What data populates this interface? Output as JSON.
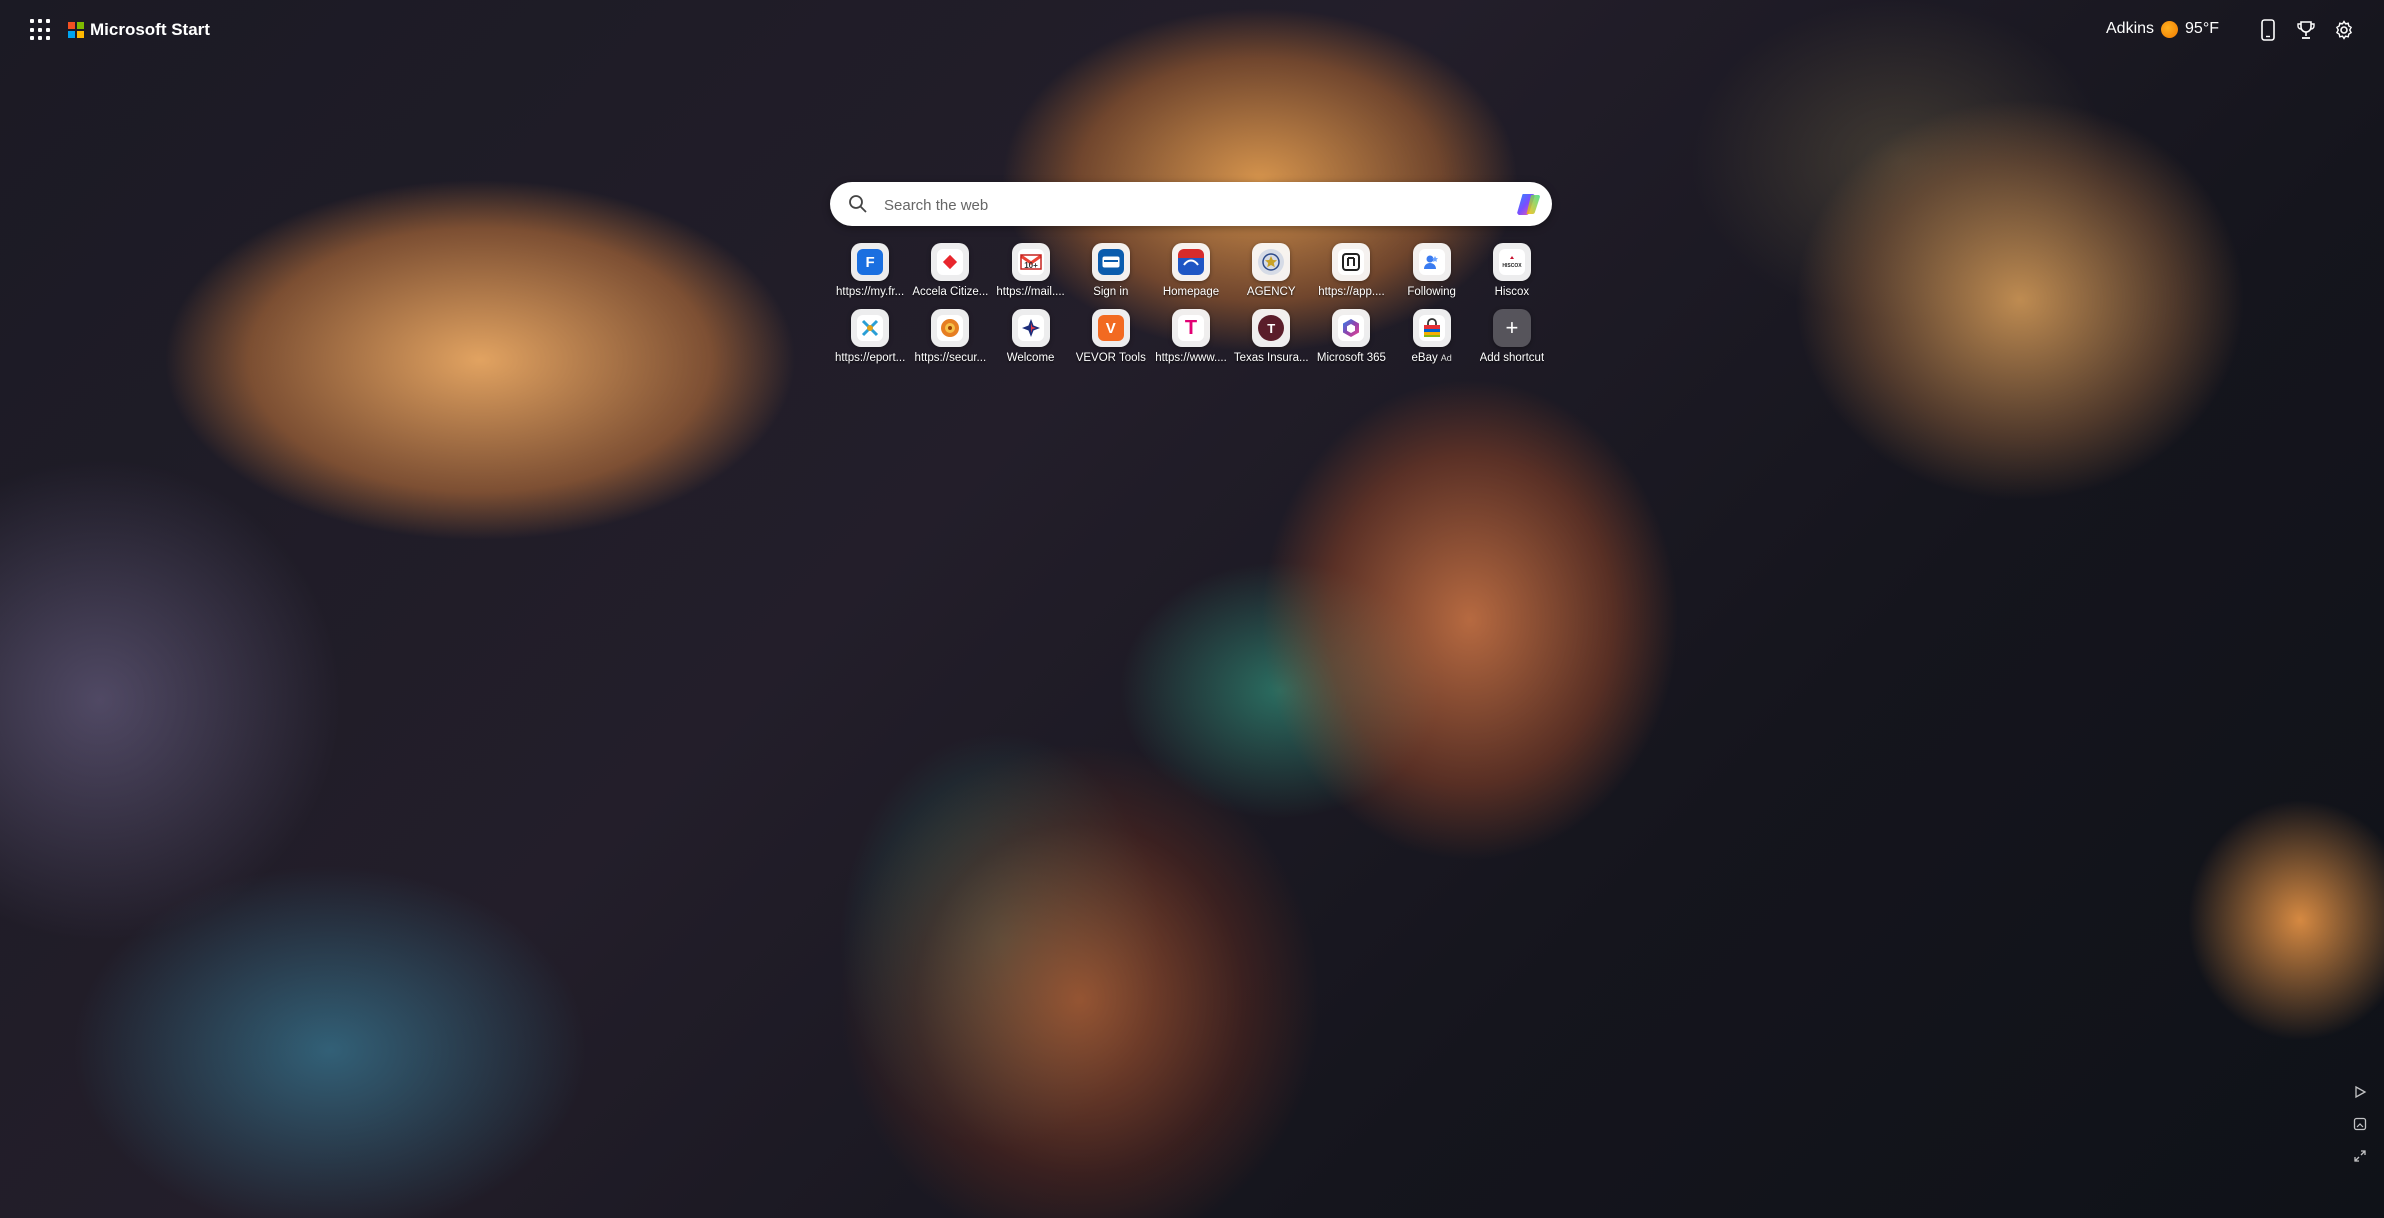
{
  "header": {
    "brand": "Microsoft Start",
    "weather_location": "Adkins",
    "weather_temp": "95°F",
    "colors": {
      "logo_red": "#f25022",
      "logo_green": "#7fba00",
      "logo_blue": "#00a4ef",
      "logo_yellow": "#ffb900"
    }
  },
  "search": {
    "placeholder": "Search the web"
  },
  "shortcuts": {
    "row1": [
      {
        "label": "https://my.fr...",
        "icon": "f-letter-icon"
      },
      {
        "label": "Accela Citize...",
        "icon": "accela-icon"
      },
      {
        "label": "https://mail....",
        "icon": "gmail-icon"
      },
      {
        "label": "Sign in",
        "icon": "signin-card-icon"
      },
      {
        "label": "Homepage",
        "icon": "homepage-icon"
      },
      {
        "label": "AGENCY",
        "icon": "agency-seal-icon"
      },
      {
        "label": "https://app....",
        "icon": "app-square-icon"
      },
      {
        "label": "Following",
        "icon": "following-icon"
      },
      {
        "label": "Hiscox",
        "icon": "hiscox-icon"
      }
    ],
    "row2": [
      {
        "label": "https://eport...",
        "icon": "eport-icon"
      },
      {
        "label": "https://secur...",
        "icon": "secure-icon"
      },
      {
        "label": "Welcome",
        "icon": "welcome-star-icon"
      },
      {
        "label": "VEVOR Tools",
        "icon": "vevor-icon"
      },
      {
        "label": "https://www....",
        "icon": "t-mobile-icon"
      },
      {
        "label": "Texas Insura...",
        "icon": "texas-insurance-icon"
      },
      {
        "label": "Microsoft 365",
        "icon": "microsoft-365-icon"
      },
      {
        "label": "eBay",
        "ad": "Ad",
        "icon": "ebay-bag-icon"
      },
      {
        "label": "Add shortcut",
        "icon": "plus-icon"
      }
    ]
  }
}
